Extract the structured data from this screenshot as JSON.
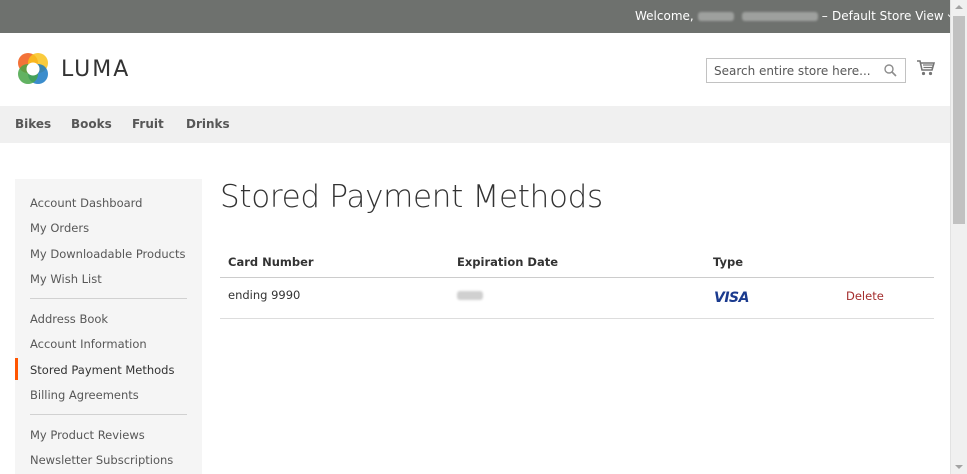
{
  "topbar": {
    "welcome_label": "Welcome,",
    "store_view": "Default Store View"
  },
  "header": {
    "logo_text": "LUMA",
    "search_placeholder": "Search entire store here..."
  },
  "nav": {
    "items": [
      "Bikes",
      "Books",
      "Fruit",
      "Drinks"
    ]
  },
  "sidebar": {
    "groups": [
      [
        "Account Dashboard",
        "My Orders",
        "My Downloadable Products",
        "My Wish List"
      ],
      [
        "Address Book",
        "Account Information",
        "Stored Payment Methods",
        "Billing Agreements"
      ],
      [
        "My Product Reviews",
        "Newsletter Subscriptions"
      ]
    ],
    "active": "Stored Payment Methods"
  },
  "main": {
    "title": "Stored Payment Methods",
    "columns": [
      "Card Number",
      "Expiration Date",
      "Type"
    ],
    "rows": [
      {
        "card_number": "ending 9990",
        "type": "VISA",
        "action": "Delete"
      }
    ]
  },
  "colors": {
    "topbar": "#6e716e",
    "nav_bg": "#f0f0f0",
    "accent": "#ff5501",
    "delete": "#a32c2c"
  }
}
